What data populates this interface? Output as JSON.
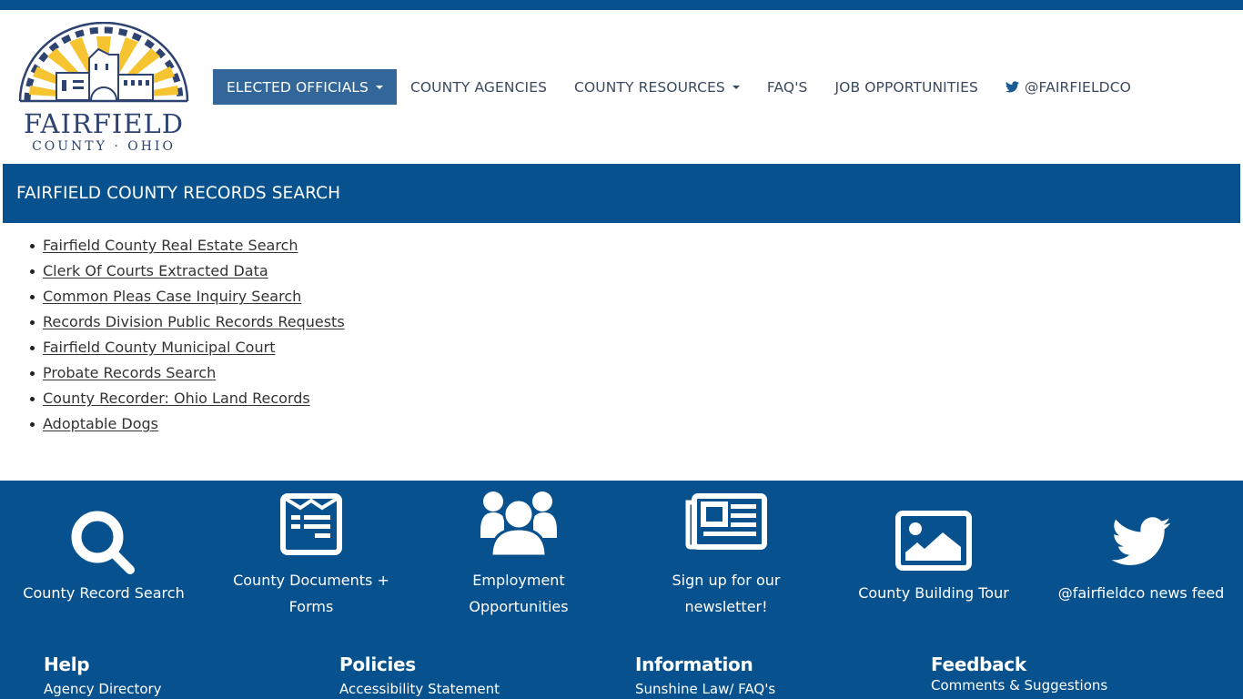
{
  "header": {
    "logo": {
      "name": "FAIRFIELD",
      "subtitle": "COUNTY · OHIO"
    },
    "nav": [
      {
        "label": "ELECTED OFFICIALS",
        "dropdown": true,
        "active": true
      },
      {
        "label": "COUNTY AGENCIES",
        "dropdown": false
      },
      {
        "label": "COUNTY RESOURCES",
        "dropdown": true
      },
      {
        "label": "FAQ'S",
        "dropdown": false
      },
      {
        "label": "JOB OPPORTUNITIES",
        "dropdown": false
      },
      {
        "label": "@FAIRFIELDCO",
        "icon": "twitter-icon"
      }
    ]
  },
  "page": {
    "title": "FAIRFIELD COUNTY RECORDS SEARCH",
    "links": [
      "Fairfield County Real Estate Search",
      "Clerk Of Courts Extracted Data",
      "Common Pleas Case Inquiry Search",
      "Records Division Public Records Requests",
      "Fairfield County Municipal Court",
      "Probate Records Search",
      "County Recorder: Ohio Land Records",
      "Adoptable Dogs"
    ]
  },
  "footer": {
    "tiles": [
      {
        "label": "County Record Search",
        "icon": "search-icon"
      },
      {
        "label_line1": "County Documents +",
        "label_line2": "Forms",
        "icon": "document-form-icon"
      },
      {
        "label_line1": "Employment",
        "label_line2": "Opportunities",
        "icon": "users-group-icon"
      },
      {
        "label_line1": "Sign up for our",
        "label_line2": "newsletter!",
        "icon": "newspaper-icon"
      },
      {
        "label": "County Building Tour",
        "icon": "image-icon"
      },
      {
        "label": "@fairfieldco news feed",
        "icon": "twitter-icon"
      }
    ],
    "columns": [
      {
        "heading": "Help",
        "links": [
          "Agency Directory"
        ]
      },
      {
        "heading": "Policies",
        "links": [
          "Accessibility Statement"
        ]
      },
      {
        "heading": "Information",
        "links": [
          "Sunshine Law/ FAQ's"
        ]
      },
      {
        "heading": "Feedback",
        "links": [
          "Comments & Suggestions"
        ]
      }
    ]
  },
  "colors": {
    "brand_blue": "#07528e",
    "nav_active": "#336699",
    "nav_text": "#3c4a5e",
    "logo_gold": "#f5c430",
    "logo_navy": "#2e4370"
  }
}
